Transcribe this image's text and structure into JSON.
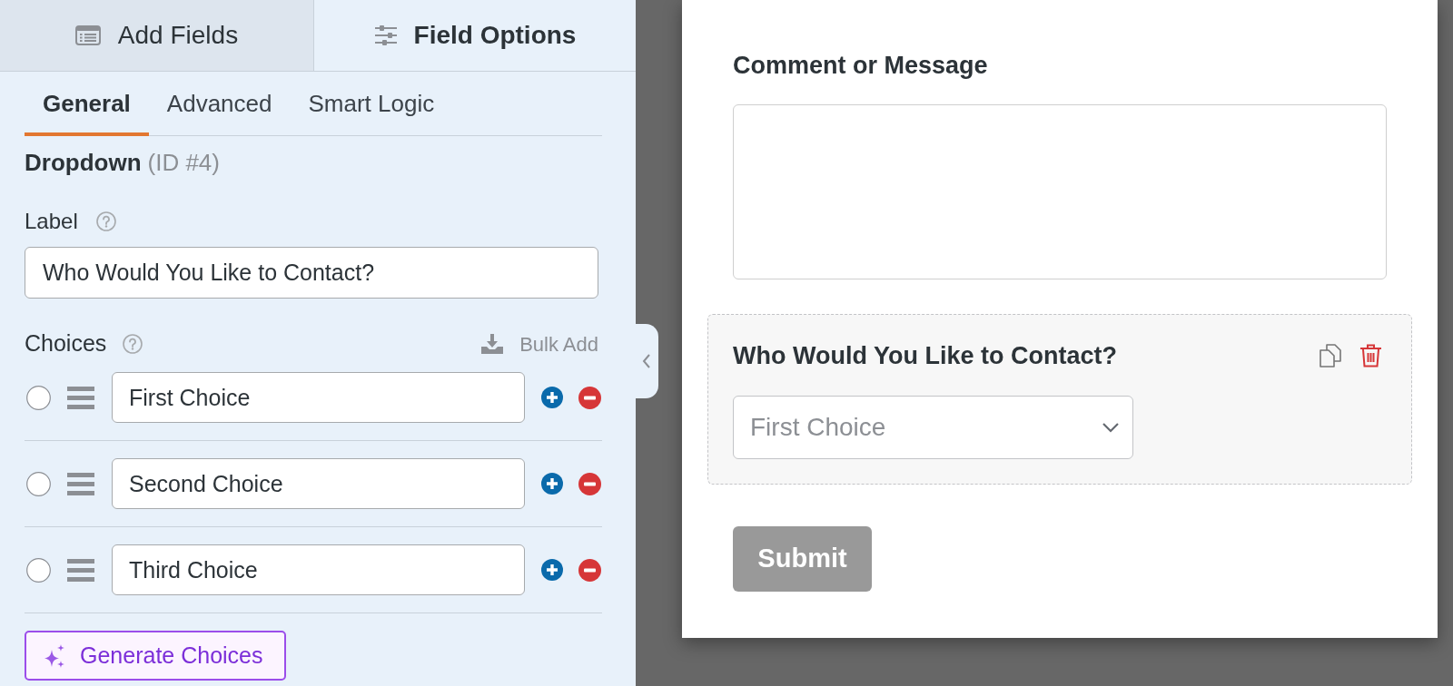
{
  "sidebar": {
    "tabs": [
      {
        "label": "Add Fields",
        "selected": false
      },
      {
        "label": "Field Options",
        "selected": true
      }
    ],
    "subtabs": [
      {
        "label": "General",
        "selected": true
      },
      {
        "label": "Advanced",
        "selected": false
      },
      {
        "label": "Smart Logic",
        "selected": false
      }
    ],
    "field_type": "Dropdown",
    "field_id": "(ID #4)",
    "label_field": {
      "label": "Label",
      "value": "Who Would You Like to Contact?"
    },
    "choices": {
      "label": "Choices",
      "bulk_add": "Bulk Add",
      "items": [
        {
          "value": "First Choice",
          "selected": false
        },
        {
          "value": "Second Choice",
          "selected": false
        },
        {
          "value": "Third Choice",
          "selected": false
        }
      ]
    },
    "generate_button": "Generate Choices"
  },
  "preview": {
    "fields": [
      {
        "kind": "textarea",
        "label": "Comment or Message",
        "selected": false
      },
      {
        "kind": "select",
        "label": "Who Would You Like to Contact?",
        "value": "First Choice",
        "selected": true
      }
    ],
    "submit": "Submit"
  }
}
